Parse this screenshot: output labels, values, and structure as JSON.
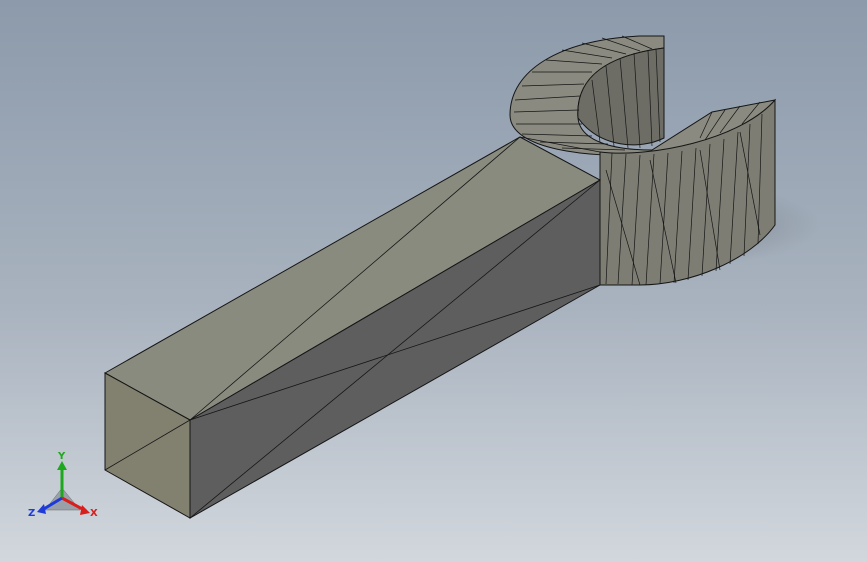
{
  "viewport": {
    "background_top": "#8c9aab",
    "background_bottom": "#d2d7dd",
    "display_style": "shaded-with-edges"
  },
  "model": {
    "name_visible": false,
    "face_colors": {
      "top": "#8a8b7f",
      "side": "#5e5e5e",
      "end": "#82816f",
      "ring_outer": "#8a8a80",
      "ring_inner": "#6d6d66"
    },
    "edge_color": "#151515"
  },
  "triad": {
    "x_label": "X",
    "y_label": "Y",
    "z_label": "Z",
    "x_color": "#d91e1e",
    "y_color": "#1ea81e",
    "z_color": "#1e3ad9"
  }
}
